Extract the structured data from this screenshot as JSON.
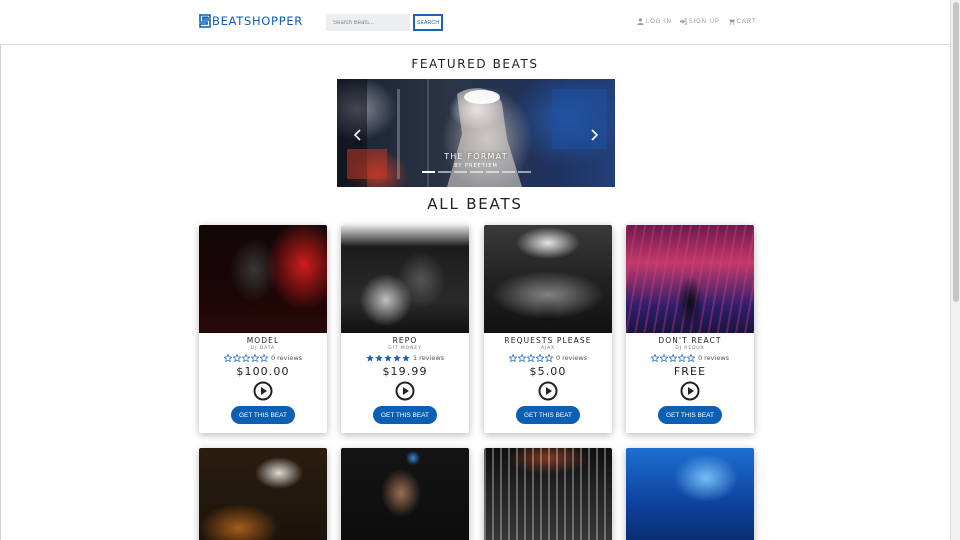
{
  "navbar": {
    "brand": "BEATSHOPPER",
    "search_placeholder": "Search Beats...",
    "search_button": "SEARCH",
    "links": [
      {
        "label": "LOG IN",
        "icon": "user-icon"
      },
      {
        "label": "SIGN UP",
        "icon": "sign-in-icon"
      },
      {
        "label": "CART",
        "icon": "cart-icon"
      }
    ]
  },
  "featured": {
    "heading": "FEATURED BEATS",
    "slide_title": "THE FORMAT",
    "slide_subtitle": "BY PREETIEM",
    "slide_count": 7,
    "active_slide": 0
  },
  "all_beats": {
    "heading": "ALL BEATS",
    "button_label": "GET THIS BEAT",
    "beats": [
      {
        "title": "MODEL",
        "artist": "DJ DATA",
        "stars": 0,
        "reviews": "0 reviews",
        "price": "$100.00"
      },
      {
        "title": "REPO",
        "artist": "GIT MONEY",
        "stars": 5,
        "reviews": "1 reviews",
        "price": "$19.99"
      },
      {
        "title": "REQUESTS PLEASE",
        "artist": "AJAX",
        "stars": 0,
        "reviews": "0 reviews",
        "price": "$5.00"
      },
      {
        "title": "DON'T REACT",
        "artist": "DJ REDUX",
        "stars": 0,
        "reviews": "0 reviews",
        "price": "FREE"
      }
    ]
  },
  "colors": {
    "brand_blue": "#0d5fb3",
    "star_blue": "#1b63b8",
    "nav_gray": "#9a9a9a"
  }
}
